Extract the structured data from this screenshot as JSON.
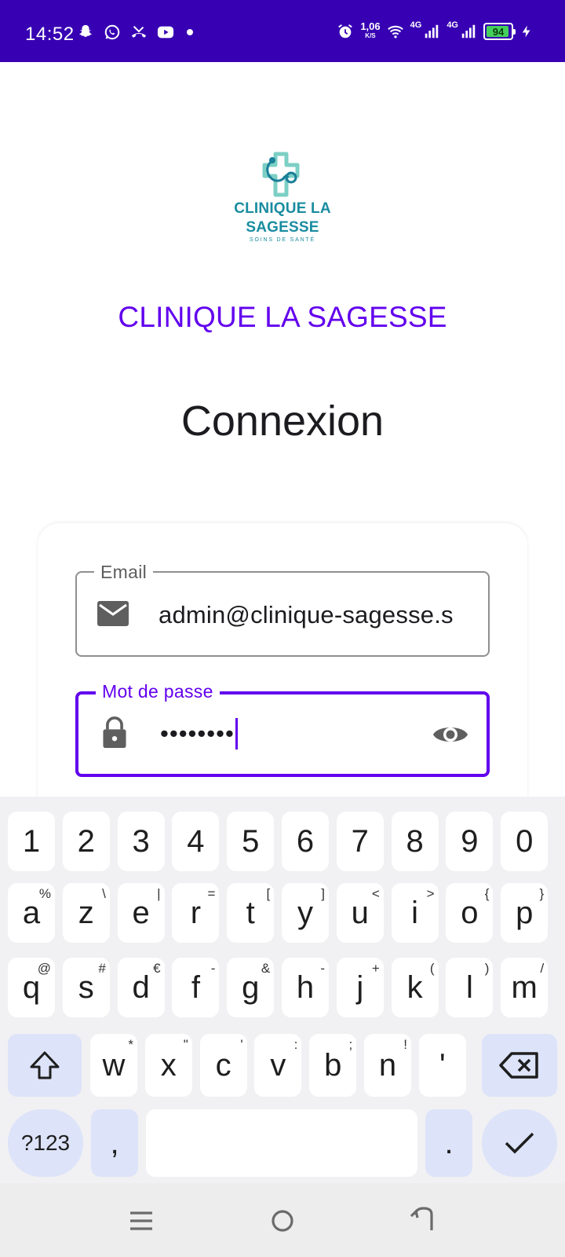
{
  "status_bar": {
    "time": "14:52",
    "speed_value": "1,06",
    "speed_unit": "K/S",
    "net1": "4G",
    "net2": "4G",
    "battery": "94",
    "battery_level": 0.94,
    "color": "#3700b3"
  },
  "logo": {
    "line1": "CLINIQUE LA",
    "line2": "SAGESSE",
    "tagline": "SOINS DE SANTÉ"
  },
  "brand_title": "CLINIQUE LA SAGESSE",
  "page_title": "Connexion",
  "form": {
    "email": {
      "label": "Email",
      "value": "admin@clinique-sagesse.s",
      "icon": "mail-icon"
    },
    "password": {
      "label": "Mot de passe",
      "value": "••••••••",
      "icon": "lock-icon",
      "toggle_icon": "eye-icon"
    }
  },
  "keyboard": {
    "row_numbers": [
      "1",
      "2",
      "3",
      "4",
      "5",
      "6",
      "7",
      "8",
      "9",
      "0"
    ],
    "row1": [
      {
        "k": "a",
        "h": "%"
      },
      {
        "k": "z",
        "h": "\\"
      },
      {
        "k": "e",
        "h": "|"
      },
      {
        "k": "r",
        "h": "="
      },
      {
        "k": "t",
        "h": "["
      },
      {
        "k": "y",
        "h": "]"
      },
      {
        "k": "u",
        "h": "<"
      },
      {
        "k": "i",
        "h": ">"
      },
      {
        "k": "o",
        "h": "{"
      },
      {
        "k": "p",
        "h": "}"
      }
    ],
    "row2": [
      {
        "k": "q",
        "h": "@"
      },
      {
        "k": "s",
        "h": "#"
      },
      {
        "k": "d",
        "h": "€"
      },
      {
        "k": "f",
        "h": "-"
      },
      {
        "k": "g",
        "h": "&"
      },
      {
        "k": "h",
        "h": "-"
      },
      {
        "k": "j",
        "h": "+"
      },
      {
        "k": "k",
        "h": "("
      },
      {
        "k": "l",
        "h": ")"
      },
      {
        "k": "m",
        "h": "/"
      }
    ],
    "row3": [
      {
        "k": "w",
        "h": "*"
      },
      {
        "k": "x",
        "h": "\""
      },
      {
        "k": "c",
        "h": "'"
      },
      {
        "k": "v",
        "h": ":"
      },
      {
        "k": "b",
        "h": ";"
      },
      {
        "k": "n",
        "h": "!"
      },
      {
        "k": "'",
        "h": ""
      }
    ],
    "symbols_label": "?123",
    "comma": ",",
    "period": ".",
    "accent": "#dde3f9"
  },
  "nav": {
    "recents": "menu-icon",
    "home": "home-icon",
    "back": "back-icon"
  }
}
